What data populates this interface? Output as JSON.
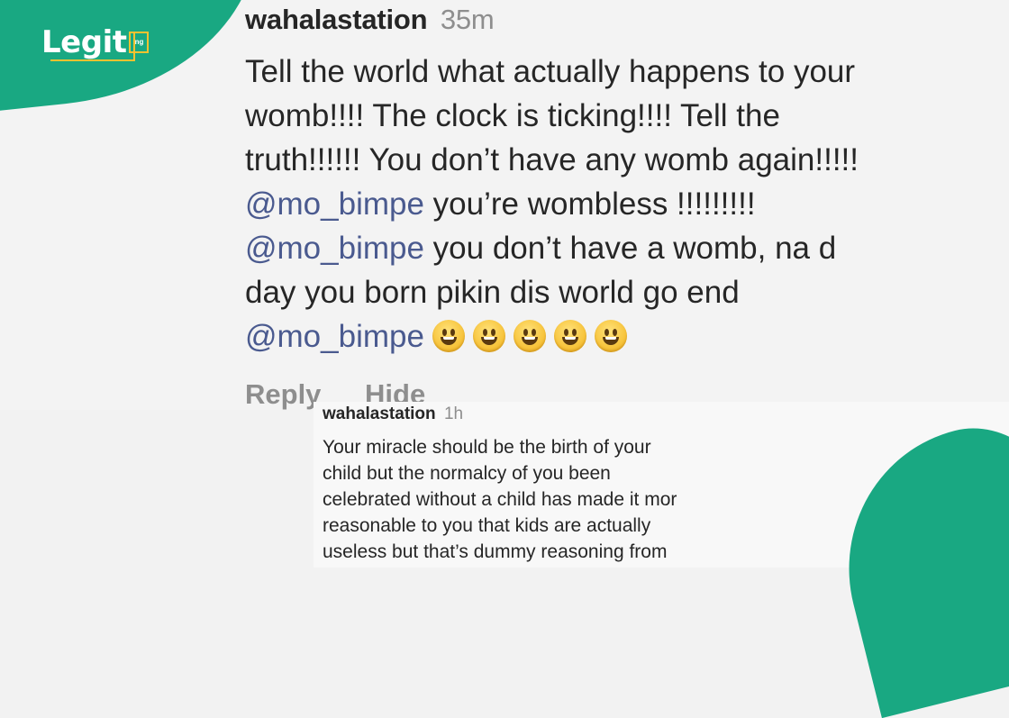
{
  "brand": {
    "logo_text": "Legit",
    "logo_suffix": "ng",
    "brand_color": "#19a882",
    "accent_color": "#f2c230"
  },
  "comment_main": {
    "username": "wahalastation",
    "time": "35m",
    "lines": [
      [
        {
          "text": "Tell the world what actually happens to your"
        }
      ],
      [
        {
          "text": "womb!!!! The clock is ticking!!!! Tell the"
        }
      ],
      [
        {
          "text": "truth!!!!!! You don’t have any womb again!!!!!"
        }
      ],
      [
        {
          "mention": "@mo_bimpe"
        },
        {
          "text": " you’re wombless !!!!!!!!!"
        }
      ],
      [
        {
          "mention": "@mo_bimpe"
        },
        {
          "text": " you don’t have a womb, na d"
        }
      ],
      [
        {
          "text": "day you born pikin dis world go end"
        }
      ],
      [
        {
          "mention": "@mo_bimpe"
        }
      ]
    ],
    "emoji_count": 5,
    "emoji_icon": "grinning-face-icon",
    "actions": {
      "reply": "Reply",
      "hide": "Hide"
    }
  },
  "comment_second": {
    "username": "wahalastation",
    "time": "1h",
    "lines": [
      "Your miracle should be the birth of your",
      "child but the normalcy of you been",
      "celebrated without a child has made it mor",
      "reasonable to you that kids are actually",
      "useless but that’s dummy reasoning from"
    ]
  },
  "colors": {
    "mention": "#4a5a8f",
    "text": "#262626",
    "muted": "#8e8e8e"
  }
}
